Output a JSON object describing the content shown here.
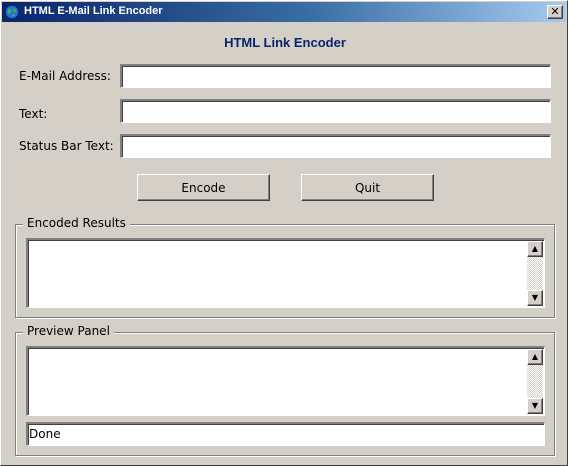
{
  "window": {
    "title": "HTML E-Mail Link Encoder",
    "close_glyph": "✕"
  },
  "heading": "HTML Link Encoder",
  "form": {
    "email_label": "E-Mail Address:",
    "email_value": "",
    "text_label": "Text:",
    "text_value": "",
    "status_label": "Status Bar Text:",
    "status_value": ""
  },
  "buttons": {
    "encode": "Encode",
    "quit": "Quit"
  },
  "encoded_results": {
    "label": "Encoded Results",
    "value": ""
  },
  "preview_panel": {
    "label": "Preview Panel",
    "status_text": "Done"
  },
  "icons": {
    "app": "globe-icon",
    "scroll_up": "scroll-up-arrow-icon",
    "scroll_down": "scroll-down-arrow-icon"
  },
  "colors": {
    "title_gradient_start": "#0a246a",
    "title_gradient_end": "#a6caf0",
    "heading": "#0a246a",
    "window_bg": "#d4d0c8"
  }
}
